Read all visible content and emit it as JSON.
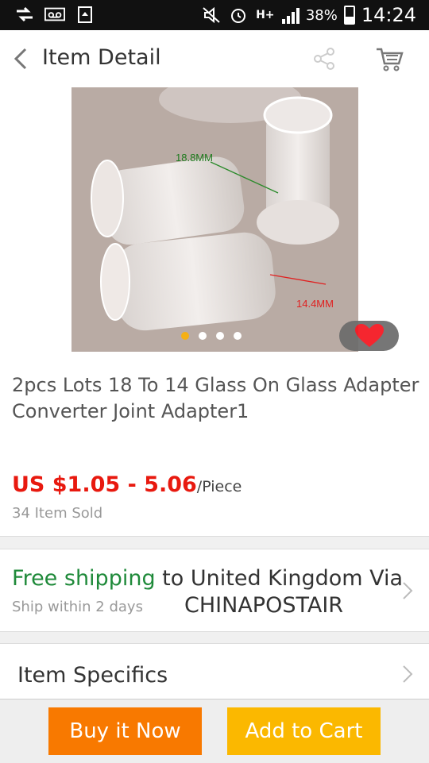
{
  "status_bar": {
    "battery": "38%",
    "time": "14:24"
  },
  "header": {
    "title": "Item Detail"
  },
  "gallery": {
    "image_count": 4,
    "active_index": 0,
    "labels": [
      "18.8MM",
      "14.4MM"
    ]
  },
  "product": {
    "name": "2pcs Lots 18 To 14 Glass On Glass Adapter Converter Joint Adapter1"
  },
  "price": {
    "range": "US $1.05 - 5.06",
    "unit": "/Piece",
    "sold": "34 Item Sold"
  },
  "shipping": {
    "free": "Free shipping",
    "dest": " to United Kingdom Via",
    "carrier": "CHINAPOSTAIR",
    "eta": "Ship within 2 days"
  },
  "specifics": {
    "label": "Item Specifics"
  },
  "actions": {
    "buy": "Buy it Now",
    "add": "Add to Cart"
  },
  "colors": {
    "price_red": "#e8190f",
    "ship_green": "#1f8a3a",
    "buy_orange": "#f87900",
    "cart_yellow": "#fbb800",
    "active_dot": "#f5b014"
  }
}
